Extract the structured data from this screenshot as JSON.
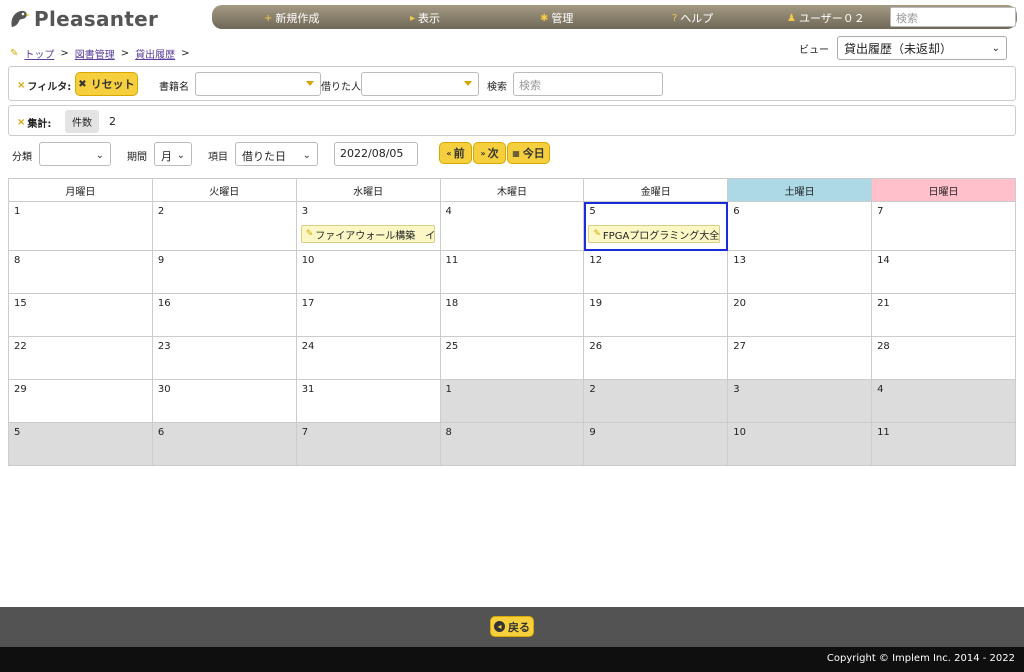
{
  "app": {
    "name": "Pleasanter"
  },
  "nav": {
    "items": [
      {
        "icon": "plus-icon",
        "glyph": "+",
        "label": "新規作成"
      },
      {
        "icon": "chevron-right-icon",
        "glyph": "▸",
        "label": "表示"
      },
      {
        "icon": "gear-icon",
        "glyph": "✱",
        "label": "管理"
      },
      {
        "icon": "help-icon",
        "glyph": "?",
        "label": "ヘルプ"
      },
      {
        "icon": "user-icon",
        "glyph": "♟",
        "label": "ユーザー０２"
      }
    ],
    "search_placeholder": "検索"
  },
  "breadcrumb": {
    "items": [
      "トップ",
      "図書管理",
      "貸出履歴"
    ],
    "separator": ">"
  },
  "view": {
    "label": "ビュー",
    "selected": "貸出履歴（未返却）"
  },
  "filter": {
    "label": "フィルタ:",
    "reset_label": "リセット",
    "book_label": "書籍名",
    "borrower_label": "借りた人",
    "search_label": "検索",
    "search_placeholder": "検索"
  },
  "aggregate": {
    "label": "集計:",
    "chip": "件数",
    "value": "2"
  },
  "controls": {
    "category_label": "分類",
    "period_label": "期間",
    "period_value": "月",
    "item_label": "項目",
    "item_value": "借りた日",
    "date_value": "2022/08/05",
    "prev_label": "前",
    "next_label": "次",
    "today_label": "今日"
  },
  "calendar": {
    "weekdays": [
      "月曜日",
      "火曜日",
      "水曜日",
      "木曜日",
      "金曜日",
      "土曜日",
      "日曜日"
    ],
    "weeks": [
      [
        "1",
        "2",
        "3",
        "4",
        "5",
        "6",
        "7"
      ],
      [
        "8",
        "9",
        "10",
        "11",
        "12",
        "13",
        "14"
      ],
      [
        "15",
        "16",
        "17",
        "18",
        "19",
        "20",
        "21"
      ],
      [
        "22",
        "23",
        "24",
        "25",
        "26",
        "27",
        "28"
      ],
      [
        "29",
        "30",
        "31",
        "1",
        "2",
        "3",
        "4"
      ],
      [
        "5",
        "6",
        "7",
        "8",
        "9",
        "10",
        "11"
      ]
    ],
    "events": [
      {
        "label": "ファイアウォール構築　インター"
      },
      {
        "label": "FPGAプログラミング大全　Xi"
      }
    ]
  },
  "footer": {
    "back_label": "戻る",
    "copyright": "Copyright © Implem Inc. 2014 - 2022"
  },
  "colors": {
    "accent": "#f6cf3e",
    "saturday": "#add8e6",
    "sunday": "#ffc0cb",
    "today_border": "#1a2bd8"
  }
}
